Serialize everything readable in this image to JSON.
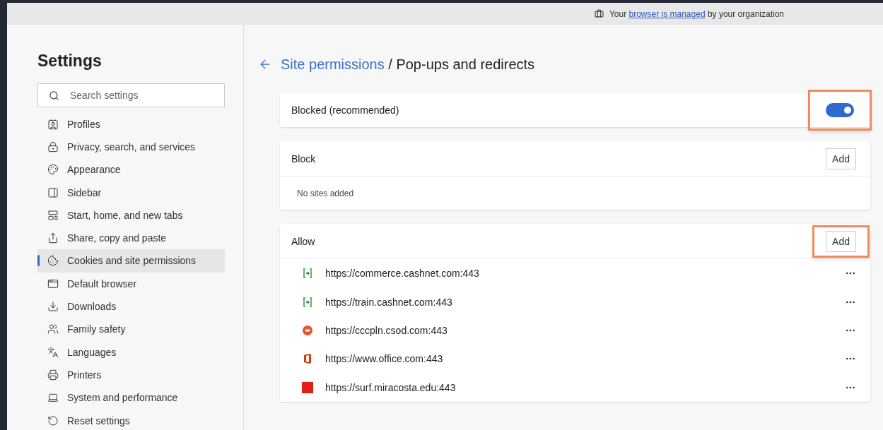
{
  "managed_notice": {
    "before": "Your",
    "link": "browser is managed",
    "after": "by your organization"
  },
  "sidebar": {
    "title": "Settings",
    "search": {
      "placeholder": "Search settings"
    },
    "items": [
      {
        "label": "Profiles",
        "kind": "profiles",
        "selected": false
      },
      {
        "label": "Privacy, search, and services",
        "kind": "privacy",
        "selected": false
      },
      {
        "label": "Appearance",
        "kind": "appearance",
        "selected": false
      },
      {
        "label": "Sidebar",
        "kind": "sidebar",
        "selected": false
      },
      {
        "label": "Start, home, and new tabs",
        "kind": "start",
        "selected": false
      },
      {
        "label": "Share, copy and paste",
        "kind": "share",
        "selected": false
      },
      {
        "label": "Cookies and site permissions",
        "kind": "cookies",
        "selected": true
      },
      {
        "label": "Default browser",
        "kind": "default",
        "selected": false
      },
      {
        "label": "Downloads",
        "kind": "downloads",
        "selected": false
      },
      {
        "label": "Family safety",
        "kind": "family",
        "selected": false
      },
      {
        "label": "Languages",
        "kind": "languages",
        "selected": false
      },
      {
        "label": "Printers",
        "kind": "printers",
        "selected": false
      },
      {
        "label": "System and performance",
        "kind": "system",
        "selected": false
      },
      {
        "label": "Reset settings",
        "kind": "reset",
        "selected": false
      }
    ]
  },
  "breadcrumb": {
    "parent": "Site permissions",
    "separator": "/",
    "current": "Pop-ups and redirects"
  },
  "blocked_setting": {
    "label": "Blocked (recommended)",
    "on": true,
    "highlighted": true
  },
  "block_section": {
    "title": "Block",
    "add_button": {
      "label": "Add",
      "highlighted": false
    },
    "empty_text": "No sites added"
  },
  "allow_section": {
    "title": "Allow",
    "add_button": {
      "label": "Add",
      "highlighted": true
    },
    "sites": [
      {
        "url": "https://commerce.cashnet.com:443",
        "kind": "cashnet"
      },
      {
        "url": "https://train.cashnet.com:443",
        "kind": "cashnet"
      },
      {
        "url": "https://cccpln.csod.com:443",
        "kind": "csod"
      },
      {
        "url": "https://www.office.com:443",
        "kind": "office"
      },
      {
        "url": "https://surf.miracosta.edu:443",
        "kind": "oracle"
      }
    ]
  }
}
